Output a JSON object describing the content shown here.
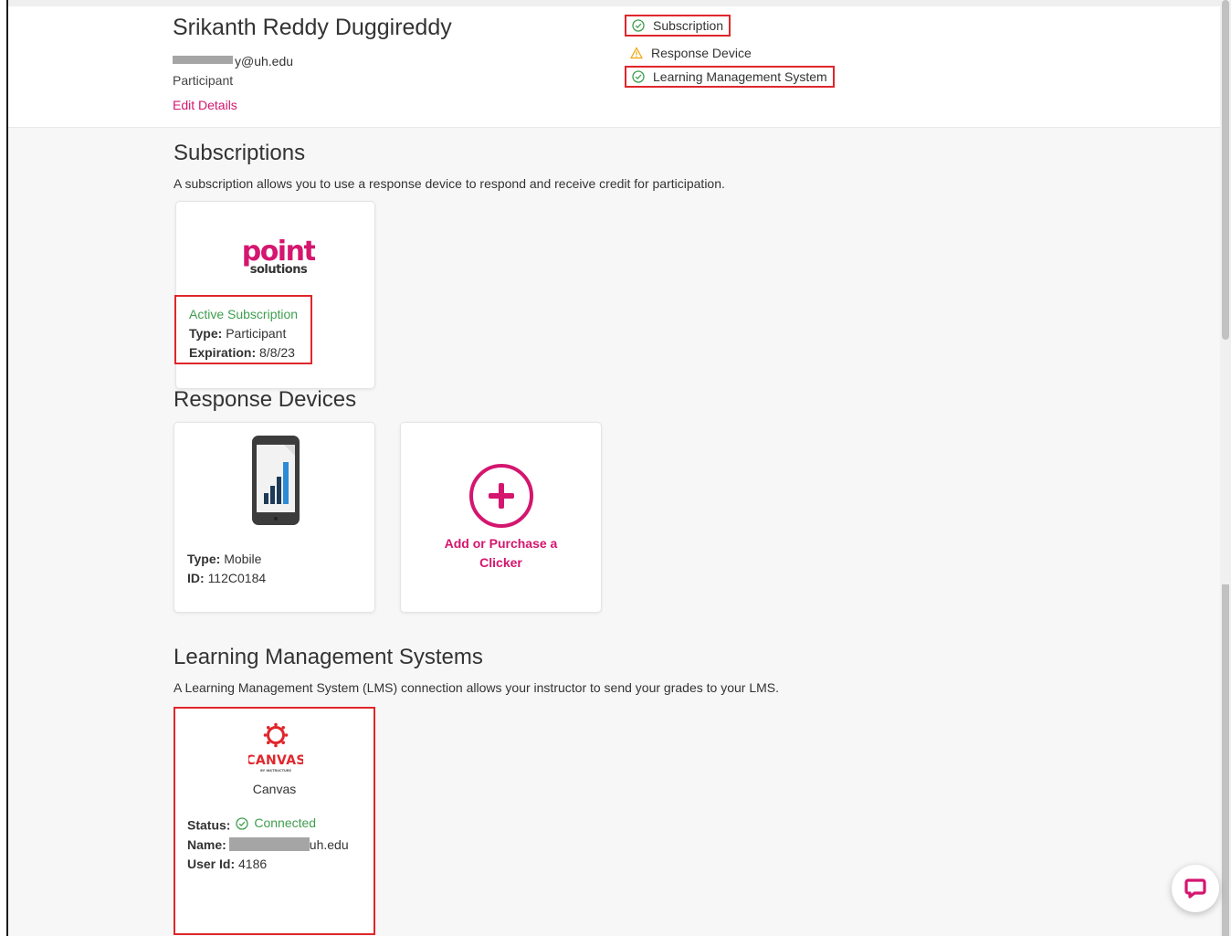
{
  "header": {
    "name": "Srikanth Reddy Duggireddy",
    "email_suffix": "y@uh.edu",
    "role": "Participant",
    "edit_link": "Edit Details"
  },
  "status_checklist": [
    {
      "label": "Subscription",
      "state": "complete",
      "icon": "check-circle-icon"
    },
    {
      "label": "Response Device",
      "state": "warning",
      "icon": "warning-triangle-icon"
    },
    {
      "label": "Learning Management System",
      "state": "complete",
      "icon": "check-circle-icon"
    }
  ],
  "subscriptions": {
    "title": "Subscriptions",
    "description": "A subscription allows you to use a response device to respond and receive credit for participation.",
    "card": {
      "logo_text_main": "point",
      "logo_text_sub": "solutions",
      "status": "Active Subscription",
      "type_label": "Type:",
      "type_value": "Participant",
      "expiration_label": "Expiration:",
      "expiration_value": "8/8/23"
    }
  },
  "response_devices": {
    "title": "Response Devices",
    "device": {
      "icon": "mobile-phone-icon",
      "type_label": "Type:",
      "type_value": "Mobile",
      "id_label": "ID:",
      "id_value": "112C0184"
    },
    "add_card": {
      "icon": "plus-circle-icon",
      "label": "Add or Purchase a Clicker"
    }
  },
  "lms": {
    "title": "Learning Management Systems",
    "description": "A Learning Management System (LMS) connection allows your instructor to send your grades to your LMS.",
    "card": {
      "logo_text": "CANVAS",
      "logo_subtext": "BY INSTRUCTURE",
      "name": "Canvas",
      "status_label": "Status:",
      "status_value": "Connected",
      "name_label": "Name:",
      "name_suffix": "uh.edu",
      "userid_label": "User Id:",
      "userid_value": "4186"
    }
  },
  "colors": {
    "accent": "#d4166f",
    "success": "#3e9e4d",
    "warning": "#f0a30a",
    "highlight_box": "#e0262b"
  },
  "chat": {
    "icon": "chat-bubble-icon"
  }
}
